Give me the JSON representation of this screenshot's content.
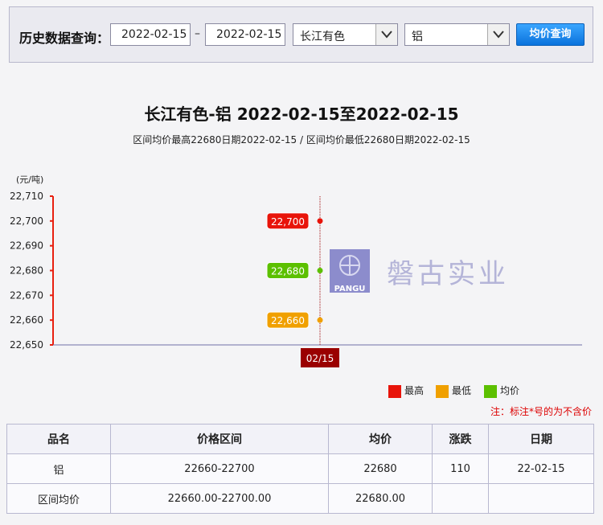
{
  "query": {
    "label": "历史数据查询：",
    "start_date": "2022-02-15",
    "separator": "–",
    "end_date": "2022-02-15",
    "market": "长江有色",
    "metal": "铝",
    "button_label": "均价查询"
  },
  "chart_data": {
    "type": "line",
    "title": "长江有色-铝 2022-02-15至2022-02-15",
    "subtitle": "区间均价最高22680日期2022-02-15 / 区间均价最低22680日期2022-02-15",
    "ylabel": "(元/吨)",
    "ylim": [
      22650,
      22710
    ],
    "yticks": [
      "22,710",
      "22,700",
      "22,690",
      "22,680",
      "22,670",
      "22,660",
      "22,650"
    ],
    "x": [
      "02/15"
    ],
    "legend_position": "bottom-right",
    "series": [
      {
        "name": "最高",
        "values": [
          22700
        ],
        "labels": [
          "22,700"
        ],
        "color": "#e8140a"
      },
      {
        "name": "最低",
        "values": [
          22660
        ],
        "labels": [
          "22,660"
        ],
        "color": "#f0a000"
      },
      {
        "name": "均价",
        "values": [
          22680
        ],
        "labels": [
          "22,680"
        ],
        "color": "#5cc000"
      }
    ]
  },
  "watermark": {
    "brand_en": "PANGU",
    "brand_cn": "磐古实业"
  },
  "note": "注：标注*号的为不含价",
  "table": {
    "headers": [
      "品名",
      "价格区间",
      "均价",
      "涨跌",
      "日期"
    ],
    "rows": [
      [
        "铝",
        "22660-22700",
        "22680",
        "110",
        "22-02-15"
      ],
      [
        "区间均价",
        "22660.00-22700.00",
        "22680.00",
        "",
        ""
      ]
    ]
  },
  "colors": {
    "accent": "#0a72dc",
    "axis": "#e82010",
    "xlabel_bg": "#9a0000"
  }
}
